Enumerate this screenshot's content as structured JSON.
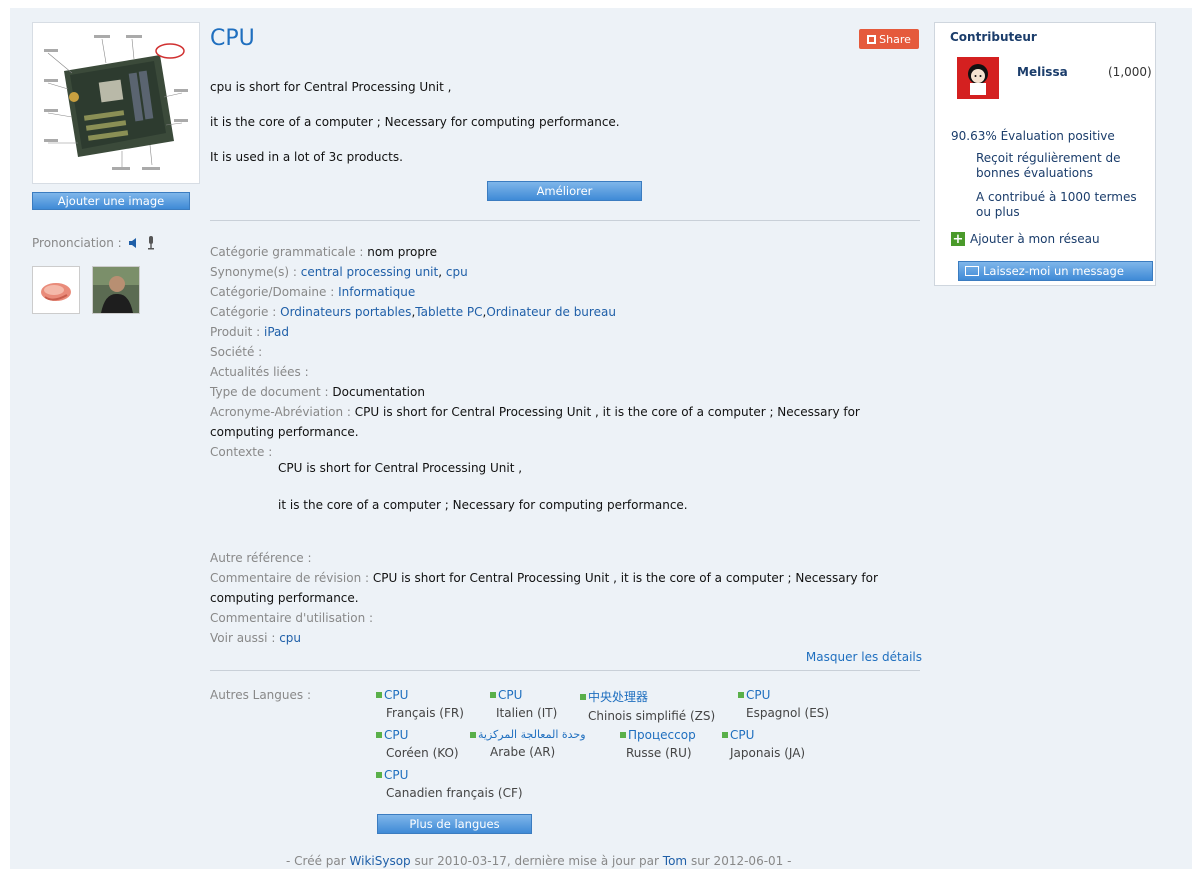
{
  "term": {
    "title": "CPU",
    "share_label": "Share",
    "description": [
      "cpu is short for Central Processing Unit ,",
      "it is the core of a computer ; Necessary for computing performance.",
      "It is used in a lot of 3c products."
    ],
    "improve_label": "Améliorer"
  },
  "left": {
    "add_image_label": "Ajouter une image",
    "pronunciation_label": "Prononciation :"
  },
  "props": {
    "grammar_label": "Catégorie grammaticale :",
    "grammar_value": "nom propre",
    "synonyms_label": "Synonyme(s) :",
    "synonyms": [
      "central processing unit",
      "cpu"
    ],
    "domain_label": "Catégorie/Domaine :",
    "domain_value": "Informatique",
    "category_label": "Catégorie :",
    "categories": [
      "Ordinateurs portables",
      "Tablette PC",
      "Ordinateur de bureau"
    ],
    "product_label": "Produit :",
    "product_value": "iPad",
    "company_label": "Société :",
    "news_label": "Actualités liées :",
    "doctype_label": "Type de document :",
    "doctype_value": "Documentation",
    "acronym_label": "Acronyme-Abréviation :",
    "acronym_value": "CPU is short for Central Processing Unit , it is the core of a computer ; Necessary for computing performance.",
    "context_label": "Contexte :",
    "context_lines": [
      "CPU is short for Central Processing Unit ,",
      "it is the core of a computer ; Necessary for computing performance."
    ],
    "other_ref_label": "Autre référence :",
    "revision_label": "Commentaire de révision :",
    "revision_value": "CPU is short for Central Processing Unit , it is the core of a computer ; Necessary for computing performance.",
    "usage_label": "Commentaire d'utilisation :",
    "see_also_label": "Voir aussi :",
    "see_also_value": "cpu",
    "hide_details": "Masquer les détails"
  },
  "languages": {
    "label": "Autres Langues :",
    "items": [
      {
        "word": "CPU",
        "name": "Français (FR)"
      },
      {
        "word": "CPU",
        "name": "Italien (IT)"
      },
      {
        "word": "中央处理器",
        "name": "Chinois simplifié (ZS)"
      },
      {
        "word": "CPU",
        "name": "Espagnol (ES)"
      },
      {
        "word": "CPU",
        "name": "Coréen (KO)"
      },
      {
        "word": "وحدة المعالجة المركزية",
        "name": "Arabe (AR)"
      },
      {
        "word": "Процессор",
        "name": "Russe (RU)"
      },
      {
        "word": "CPU",
        "name": "Japonais (JA)"
      },
      {
        "word": "CPU",
        "name": "Canadien français (CF)"
      }
    ],
    "more_label": "Plus de langues"
  },
  "footer": {
    "pre": "- Créé par",
    "creator": "WikiSysop",
    "mid1": "sur 2010-03-17, dernière mise à jour par",
    "updater": "Tom",
    "mid2": "sur 2012-06-01 -"
  },
  "contributor": {
    "title": "Contributeur",
    "name": "Melissa",
    "points": "(1,000)",
    "evaluation": "90.63% Évaluation positive",
    "bullet1": "Reçoit régulièrement de bonnes évaluations",
    "bullet2": "A contribué à 1000 termes ou plus",
    "add_network": "Ajouter à mon réseau",
    "message": "Laissez-moi un message"
  }
}
